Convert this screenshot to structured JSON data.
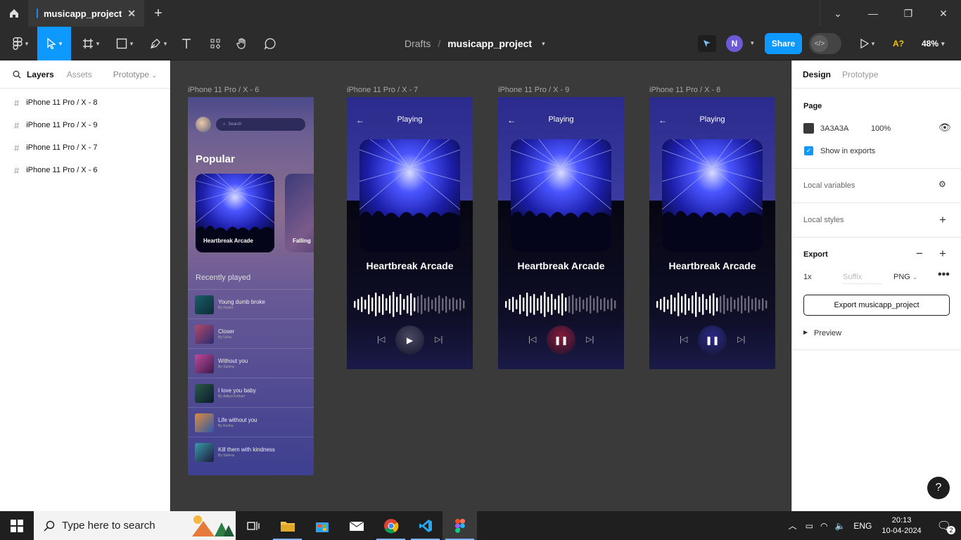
{
  "window": {
    "tab_title": "musicapp_project",
    "tab_close": "✕",
    "new_tab": "+"
  },
  "toolbar": {
    "breadcrumb_root": "Drafts",
    "breadcrumb_sep": "/",
    "project_name": "musicapp_project",
    "avatar_initial": "N",
    "share_label": "Share",
    "accessibility_label": "A?",
    "zoom": "48%"
  },
  "left_panel": {
    "tabs": {
      "layers": "Layers",
      "assets": "Assets",
      "prototype": "Prototype"
    },
    "layers": [
      "iPhone 11 Pro / X - 8",
      "iPhone 11 Pro / X - 9",
      "iPhone 11 Pro / X - 7",
      "iPhone 11 Pro / X - 6"
    ]
  },
  "canvas": {
    "frame_labels": [
      "iPhone 11 Pro / X - 6",
      "iPhone 11 Pro / X - 7",
      "iPhone 11 Pro / X - 9",
      "iPhone 11 Pro / X - 8"
    ],
    "home": {
      "search_placeholder": "Search",
      "popular_heading": "Popular",
      "card1_label": "Heartbreak Arcade",
      "card2_label": "Falling",
      "recent_heading": "Recently played",
      "songs": [
        {
          "title": "Young dumb broke",
          "artist": "By Khalid"
        },
        {
          "title": "Closer",
          "artist": "By Usha"
        },
        {
          "title": "Without you",
          "artist": "By Salena"
        },
        {
          "title": "I love you baby",
          "artist": "By Aditya Kothari"
        },
        {
          "title": "Life without you",
          "artist": "By Kesha"
        },
        {
          "title": "Kill them with kindness",
          "artist": "By Salena"
        }
      ]
    },
    "player": {
      "header": "Playing",
      "song_title": "Heartbreak Arcade",
      "button_colors": [
        "#4a4a62",
        "#8a1a3a",
        "#2a2a8a"
      ]
    }
  },
  "right_panel": {
    "tabs": {
      "design": "Design",
      "prototype": "Prototype"
    },
    "page_heading": "Page",
    "page_color": "3A3A3A",
    "page_opacity": "100%",
    "show_in_exports": "Show in exports",
    "local_variables": "Local variables",
    "local_styles": "Local styles",
    "export_heading": "Export",
    "export_scale": "1x",
    "export_suffix_placeholder": "Suffix",
    "export_format": "PNG",
    "export_button": "Export musicapp_project",
    "preview": "Preview",
    "help": "?"
  },
  "taskbar": {
    "search_placeholder": "Type here to search",
    "language": "ENG",
    "time": "20:13",
    "date": "10-04-2024",
    "notifications": "2"
  }
}
